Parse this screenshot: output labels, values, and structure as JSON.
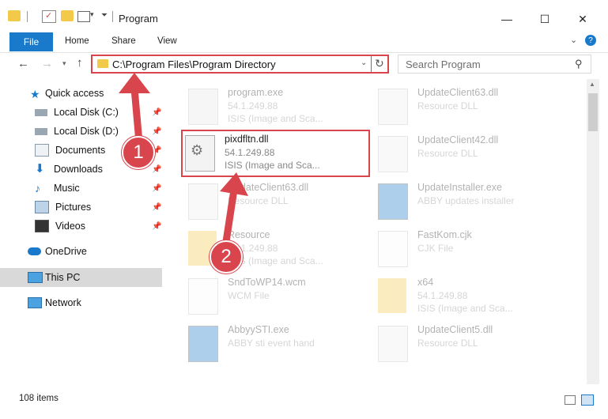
{
  "window": {
    "title": "Program",
    "minimize": "—",
    "maximize": "☐",
    "close": "✕"
  },
  "ribbon": {
    "file": "File",
    "home": "Home",
    "share": "Share",
    "view": "View"
  },
  "address": {
    "path": "C:\\Program Files\\Program Directory",
    "search_placeholder": "Search Program"
  },
  "sidebar": {
    "quick_access": "Quick access",
    "items": [
      {
        "label": "Local Disk (C:)",
        "icon": "drive-icon"
      },
      {
        "label": "Local Disk (D:)",
        "icon": "drive-icon"
      },
      {
        "label": "Documents",
        "icon": "documents-icon"
      },
      {
        "label": "Downloads",
        "icon": "downloads-icon"
      },
      {
        "label": "Music",
        "icon": "music-icon"
      },
      {
        "label": "Pictures",
        "icon": "pictures-icon"
      },
      {
        "label": "Videos",
        "icon": "videos-icon"
      }
    ],
    "onedrive": "OneDrive",
    "this_pc": "This PC",
    "network": "Network"
  },
  "files": {
    "left": [
      {
        "name": "program.exe",
        "l2": "54.1.249.88",
        "l3": "ISIS (Image and Sca..."
      },
      {
        "name": "pixdfltn.dll",
        "l2": "54.1.249.88",
        "l3": "ISIS (Image and Sca..."
      },
      {
        "name": "UpdateClient63.dll",
        "l2": "Resource DLL",
        "l3": ""
      },
      {
        "name": "Resource",
        "l2": "54.1.249.88",
        "l3": "ISIS (Image and Sca..."
      },
      {
        "name": "SndToWP14.wcm",
        "l2": "WCM File",
        "l3": ""
      },
      {
        "name": "AbbyySTI.exe",
        "l2": "ABBY sti event hand",
        "l3": ""
      }
    ],
    "right": [
      {
        "name": "UpdateClient63.dll",
        "l2": "Resource DLL"
      },
      {
        "name": "UpdateClient42.dll",
        "l2": "Resource DLL"
      },
      {
        "name": "UpdateInstaller.exe",
        "l2": "ABBY updates installer"
      },
      {
        "name": "FastKom.cjk",
        "l2": "CJK File"
      },
      {
        "name": "x64",
        "l2": "54.1.249.88",
        "l3": "ISIS (Image and Sca..."
      },
      {
        "name": "UpdateClient5.dll",
        "l2": "Resource DLL"
      }
    ]
  },
  "status": {
    "count": "108 items"
  },
  "annotations": {
    "badge1": "1",
    "badge2": "2"
  },
  "colors": {
    "accent": "#1979ca",
    "highlight": "#d9454d"
  }
}
